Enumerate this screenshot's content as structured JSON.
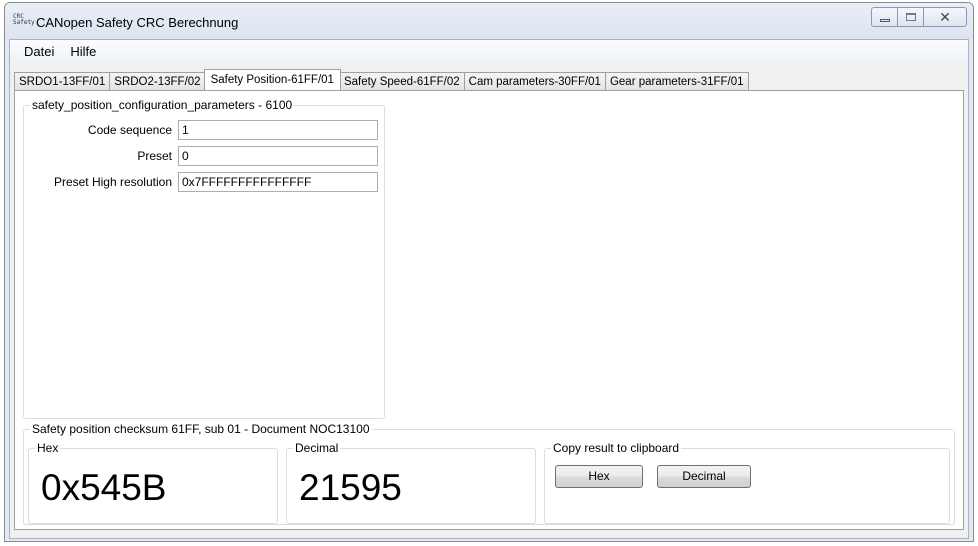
{
  "window": {
    "icon_text": "CRC\nSafety",
    "title": "CANopen Safety CRC Berechnung"
  },
  "menu": {
    "items": [
      "Datei",
      "Hilfe"
    ]
  },
  "tabs": [
    "SRDO1-13FF/01",
    "SRDO2-13FF/02",
    "Safety Position-61FF/01",
    "Safety Speed-61FF/02",
    "Cam parameters-30FF/01",
    "Gear parameters-31FF/01"
  ],
  "active_tab": "Safety Position-61FF/01",
  "config": {
    "title": "safety_position_configuration_parameters - 6100",
    "fields": [
      {
        "label": "Code sequence",
        "value": "1"
      },
      {
        "label": "Preset",
        "value": "0"
      },
      {
        "label": "Preset High resolution",
        "value": "0x7FFFFFFFFFFFFFFF"
      }
    ]
  },
  "checksum": {
    "title": "Safety position checksum 61FF, sub 01 - Document NOC13100",
    "hex_label": "Hex",
    "hex_value": "0x545B",
    "decimal_label": "Decimal",
    "decimal_value": "21595",
    "copy_label": "Copy result to clipboard",
    "copy_hex_button": "Hex",
    "copy_decimal_button": "Decimal"
  }
}
